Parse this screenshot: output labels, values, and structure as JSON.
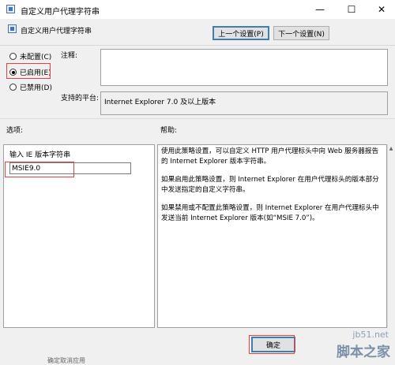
{
  "window": {
    "title": "自定义用户代理字符串",
    "controls": [
      "—",
      "☐",
      "✕"
    ]
  },
  "header": {
    "policy_name": "自定义用户代理字符串",
    "prev_button": "上一个设置(P)",
    "next_button": "下一个设置(N)"
  },
  "state": {
    "options": [
      {
        "label": "未配置(C)",
        "checked": false
      },
      {
        "label": "已启用(E)",
        "checked": true
      },
      {
        "label": "已禁用(D)",
        "checked": false
      }
    ]
  },
  "comment": {
    "label": "注释:",
    "value": ""
  },
  "platform": {
    "label": "支持的平台:",
    "value": "Internet Explorer 7.0 及以上版本"
  },
  "sections": {
    "options": "选项:",
    "help": "帮助:"
  },
  "options_pane": {
    "field_label": "输入 IE 版本字符串",
    "field_value": "MSIE9.0"
  },
  "help": {
    "paragraphs": [
      "使用此策略设置，可以自定义 HTTP 用户代理标头中向 Web 服务器报告的 Internet Explorer 版本字符串。",
      "如果启用此策略设置，则 Internet Explorer 在用户代理标头的版本部分中发送指定的自定义字符串。",
      "如果禁用或不配置此策略设置，则 Internet Explorer 在用户代理标头中发送当前 Internet Explorer 版本(如“MSIE 7.0”)。"
    ]
  },
  "footer": {
    "ok_button": "确定"
  },
  "watermark": {
    "line1": "jb51.net",
    "line2": "脚本之家"
  },
  "partial_text": "确定取消应用"
}
